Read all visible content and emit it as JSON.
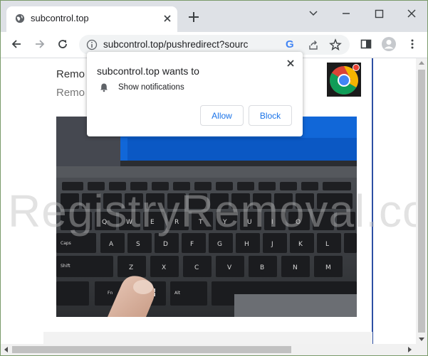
{
  "browser": {
    "tab_title": "subcontrol.top",
    "url": "subcontrol.top/pushredirect?sourc",
    "google_badge": "G",
    "icons": [
      "globe-icon",
      "close-icon",
      "plus-icon",
      "chevron-down-icon",
      "minimize-icon",
      "maximize-icon",
      "back-arrow-icon",
      "forward-arrow-icon",
      "reload-icon",
      "info-icon",
      "share-icon",
      "star-icon",
      "side-panel-icon",
      "profile-icon",
      "more-menu-icon"
    ]
  },
  "page": {
    "heading_line1": "Remo",
    "heading_line2": "Remo",
    "watermark": "RegistryRemoval.com"
  },
  "popup": {
    "title": "subcontrol.top wants to",
    "permission": "Show notifications",
    "allow_label": "Allow",
    "block_label": "Block"
  },
  "colors": {
    "accent": "#1a73e8",
    "titlebar": "#dee1e6",
    "page_bar": "#2d4fa3"
  }
}
